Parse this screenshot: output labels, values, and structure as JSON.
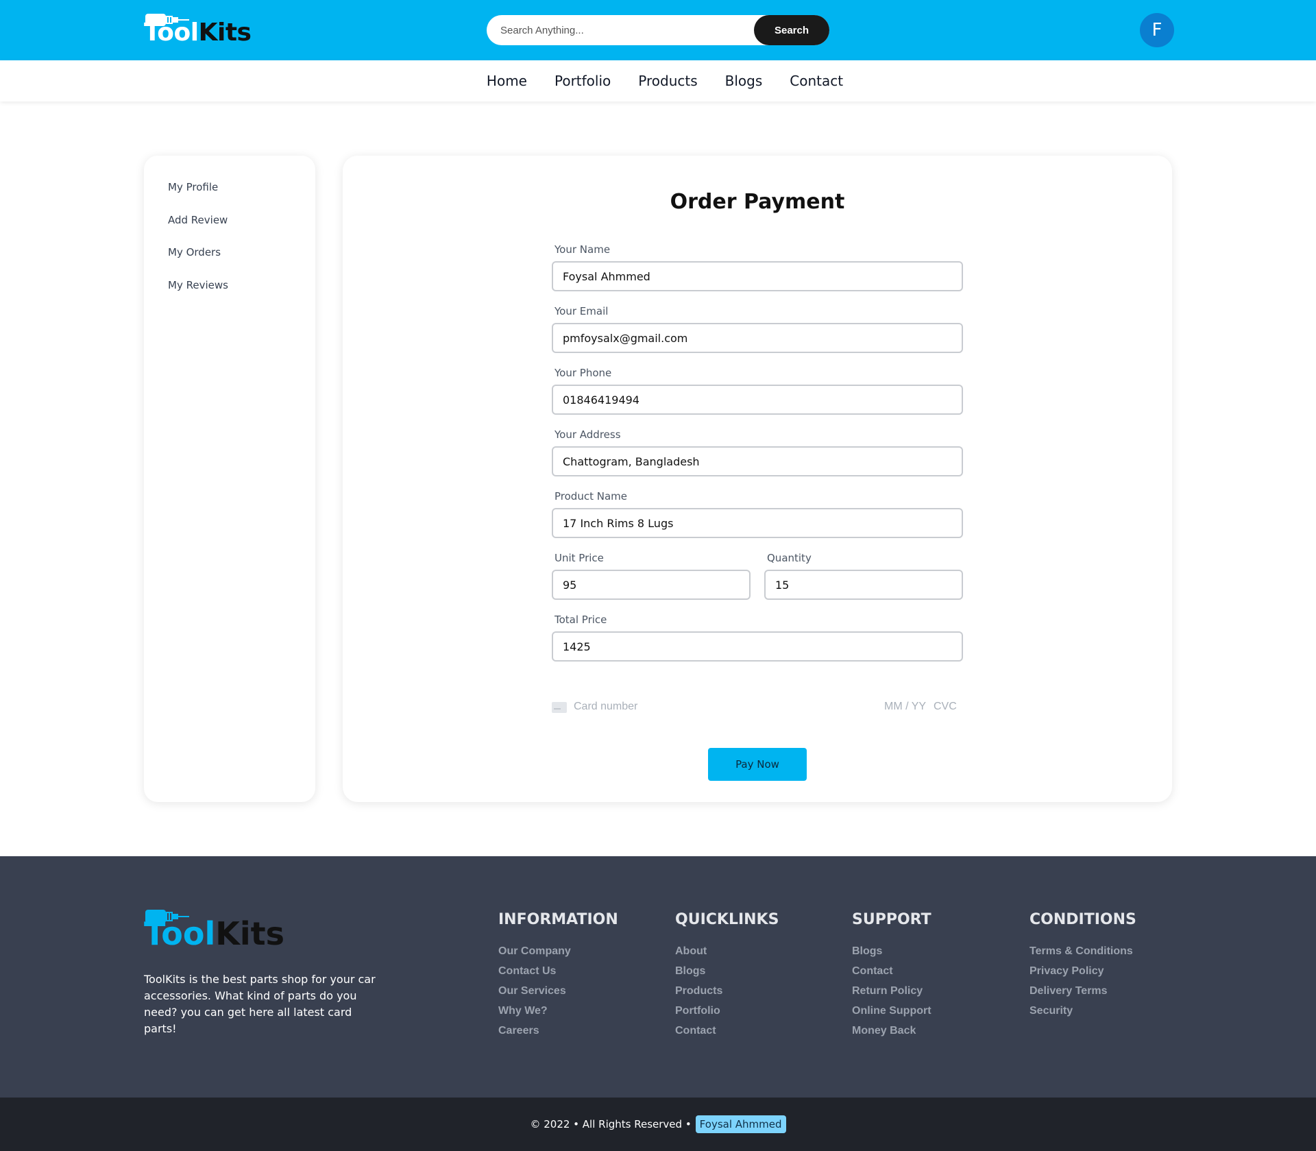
{
  "header": {
    "logo_tool": "Tool",
    "logo_kits": "Kits",
    "search_placeholder": "Search Anything...",
    "search_button": "Search",
    "avatar_letter": "F"
  },
  "nav": {
    "items": [
      "Home",
      "Portfolio",
      "Products",
      "Blogs",
      "Contact"
    ]
  },
  "sidebar": {
    "items": [
      "My Profile",
      "Add Review",
      "My Orders",
      "My Reviews"
    ]
  },
  "payment": {
    "title": "Order Payment",
    "name_label": "Your Name",
    "name_value": "Foysal Ahmmed",
    "email_label": "Your Email",
    "email_value": "pmfoysalx@gmail.com",
    "phone_label": "Your Phone",
    "phone_value": "01846419494",
    "address_label": "Your Address",
    "address_value": "Chattogram, Bangladesh",
    "product_label": "Product Name",
    "product_value": "17 Inch Rims 8 Lugs",
    "unit_price_label": "Unit Price",
    "unit_price_value": "95",
    "quantity_label": "Quantity",
    "quantity_value": "15",
    "total_label": "Total Price",
    "total_value": "1425",
    "card_number_placeholder": "Card number",
    "card_expiry_placeholder": "MM / YY",
    "card_cvc_placeholder": "CVC",
    "pay_button": "Pay Now"
  },
  "footer": {
    "logo_tool": "Tool",
    "logo_kits": "Kits",
    "description": "ToolKits is the best parts shop for your car accessories. What kind of parts do you need? you can get here all latest card parts!",
    "columns": [
      {
        "title": "INFORMATION",
        "links": [
          "Our Company",
          "Contact Us",
          "Our Services",
          "Why We?",
          "Careers"
        ]
      },
      {
        "title": "QUICKLINKS",
        "links": [
          "About",
          "Blogs",
          "Products",
          "Portfolio",
          "Contact"
        ]
      },
      {
        "title": "SUPPORT",
        "links": [
          "Blogs",
          "Contact",
          "Return Policy",
          "Online Support",
          "Money Back"
        ]
      },
      {
        "title": "CONDITIONS",
        "links": [
          "Terms & Conditions",
          "Privacy Policy",
          "Delivery Terms",
          "Security"
        ]
      }
    ],
    "copyright": "© 2022 • All Rights Reserved •",
    "author": "Foysal Ahmmed"
  },
  "colors": {
    "brand": "#00b4f0",
    "footer_bg": "#394050",
    "copyright_bg": "#20232a",
    "avatar": "#0a7fd0"
  }
}
